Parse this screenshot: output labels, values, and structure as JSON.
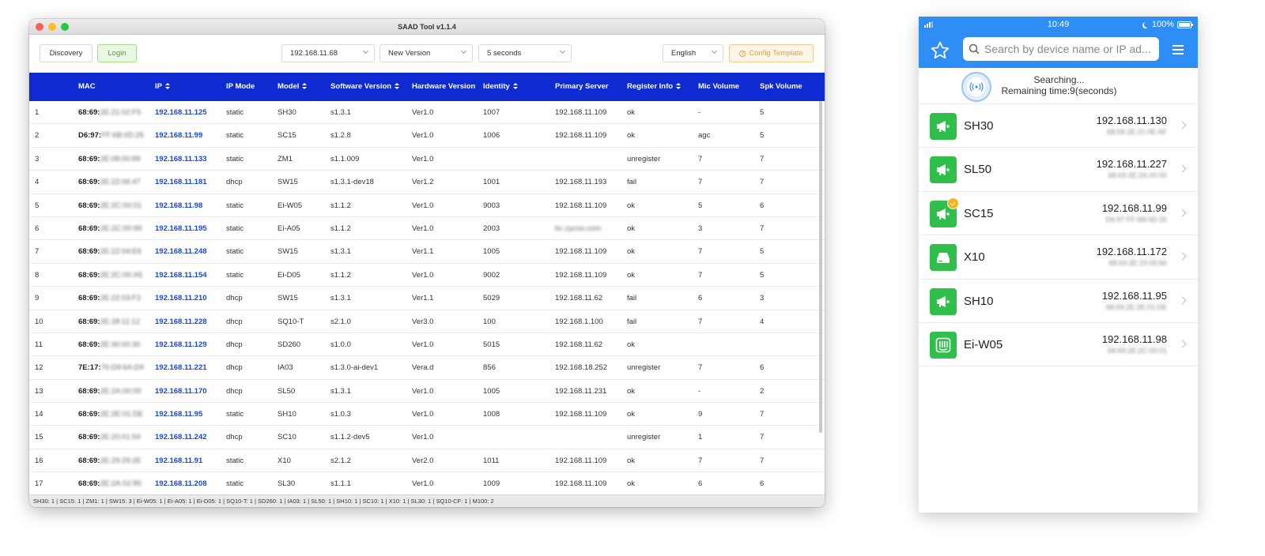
{
  "window": {
    "title": "SAAD Tool v1.1.4",
    "toolbar": {
      "discovery_label": "Discovery",
      "login_label": "Login",
      "ip_select": "192.168.11.68",
      "version_select": "New Version",
      "interval_select": "5 seconds",
      "language_select": "English",
      "config_label": "Config Template"
    },
    "columns": [
      "",
      "MAC",
      "IP",
      "IP Mode",
      "Model",
      "Software Version",
      "Hardware Version",
      "Identity",
      "Primary Server",
      "Register Info",
      "Mic Volume",
      "Spk Volume"
    ],
    "rows": [
      {
        "n": "1",
        "mac_prefix": "68:69:",
        "mac_rest": "2E:21:02:F5",
        "ip": "192.168.11.125",
        "mode": "static",
        "model": "SH30",
        "sw": "s1.3.1",
        "hw": "Ver1.0",
        "id": "1007",
        "server": "192.168.11.109",
        "server_blur": false,
        "reg": "ok",
        "mic": "-",
        "spk": "5"
      },
      {
        "n": "2",
        "mac_prefix": "D6:97:",
        "mac_rest": "FF:6B:0D:25",
        "ip": "192.168.11.99",
        "mode": "static",
        "model": "SC15",
        "sw": "s1.2.8",
        "hw": "Ver1.0",
        "id": "1006",
        "server": "192.168.11.109",
        "server_blur": false,
        "reg": "ok",
        "mic": "agc",
        "spk": "5"
      },
      {
        "n": "3",
        "mac_prefix": "68:69:",
        "mac_rest": "2E:08:00:89",
        "ip": "192.168.11.133",
        "mode": "static",
        "model": "ZM1",
        "sw": "s1.1.009",
        "hw": "Ver1.0",
        "id": "",
        "server": "",
        "server_blur": false,
        "reg": "unregister",
        "mic": "7",
        "spk": "7"
      },
      {
        "n": "4",
        "mac_prefix": "68:69:",
        "mac_rest": "2E:22:06:47",
        "ip": "192.168.11.181",
        "mode": "dhcp",
        "model": "SW15",
        "sw": "s1.3.1-dev18",
        "hw": "Ver1.2",
        "id": "1001",
        "server": "192.168.11.193",
        "server_blur": false,
        "reg": "fail",
        "mic": "7",
        "spk": "7"
      },
      {
        "n": "5",
        "mac_prefix": "68:69:",
        "mac_rest": "2E:2C:00:01",
        "ip": "192.168.11.98",
        "mode": "static",
        "model": "Ei-W05",
        "sw": "s1.1.2",
        "hw": "Ver1.0",
        "id": "9003",
        "server": "192.168.11.109",
        "server_blur": false,
        "reg": "ok",
        "mic": "5",
        "spk": "6"
      },
      {
        "n": "6",
        "mac_prefix": "68:69:",
        "mac_rest": "2E:2C:00:99",
        "ip": "192.168.11.195",
        "mode": "static",
        "model": "Ei-A05",
        "sw": "s1.1.2",
        "hw": "Ver1.0",
        "id": "2003",
        "server": "bc.zycoo.com",
        "server_blur": true,
        "reg": "ok",
        "mic": "3",
        "spk": "7"
      },
      {
        "n": "7",
        "mac_prefix": "68:69:",
        "mac_rest": "2E:22:04:E6",
        "ip": "192.168.11.248",
        "mode": "static",
        "model": "SW15",
        "sw": "s1.3.1",
        "hw": "Ver1.1",
        "id": "1005",
        "server": "192.168.11.109",
        "server_blur": false,
        "reg": "ok",
        "mic": "7",
        "spk": "5"
      },
      {
        "n": "8",
        "mac_prefix": "68:69:",
        "mac_rest": "2E:2C:00:A5",
        "ip": "192.168.11.154",
        "mode": "static",
        "model": "Ei-D05",
        "sw": "s1.1.2",
        "hw": "Ver1.0",
        "id": "9002",
        "server": "192.168.11.109",
        "server_blur": false,
        "reg": "ok",
        "mic": "7",
        "spk": "5"
      },
      {
        "n": "9",
        "mac_prefix": "68:69:",
        "mac_rest": "2E:22:03:F2",
        "ip": "192.168.11.210",
        "mode": "dhcp",
        "model": "SW15",
        "sw": "s1.3.1",
        "hw": "Ver1.1",
        "id": "5029",
        "server": "192.168.11.62",
        "server_blur": false,
        "reg": "fail",
        "mic": "6",
        "spk": "3"
      },
      {
        "n": "10",
        "mac_prefix": "68:69:",
        "mac_rest": "2E:28:11:12",
        "ip": "192.168.11.228",
        "mode": "dhcp",
        "model": "SQ10-T",
        "sw": "s2.1.0",
        "hw": "Ver3.0",
        "id": "100",
        "server": "192.168.1.100",
        "server_blur": false,
        "reg": "fail",
        "mic": "7",
        "spk": "4"
      },
      {
        "n": "11",
        "mac_prefix": "68:69:",
        "mac_rest": "2E:30:00:30",
        "ip": "192.168.11.129",
        "mode": "dhcp",
        "model": "SD260",
        "sw": "s1.0.0",
        "hw": "Ver1.0",
        "id": "5015",
        "server": "192.168.11.62",
        "server_blur": false,
        "reg": "ok",
        "mic": "",
        "spk": ""
      },
      {
        "n": "12",
        "mac_prefix": "7E:17:",
        "mac_rest": "70:D9:6A:D9",
        "ip": "192.168.11.221",
        "mode": "dhcp",
        "model": "IA03",
        "sw": "s1.3.0-ai-dev1",
        "hw": "Vera.d",
        "id": "856",
        "server": "192.168.18.252",
        "server_blur": false,
        "reg": "unregister",
        "mic": "7",
        "spk": "6"
      },
      {
        "n": "13",
        "mac_prefix": "68:69:",
        "mac_rest": "2E:2A:00:00",
        "ip": "192.168.11.170",
        "mode": "dhcp",
        "model": "SL50",
        "sw": "s1.3.1",
        "hw": "Ver1.0",
        "id": "1005",
        "server": "192.168.11.231",
        "server_blur": false,
        "reg": "ok",
        "mic": "-",
        "spk": "2"
      },
      {
        "n": "14",
        "mac_prefix": "68:69:",
        "mac_rest": "2E:2E:01:DE",
        "ip": "192.168.11.95",
        "mode": "static",
        "model": "SH10",
        "sw": "s1.0.3",
        "hw": "Ver1.0",
        "id": "1008",
        "server": "192.168.11.109",
        "server_blur": false,
        "reg": "ok",
        "mic": "9",
        "spk": "7"
      },
      {
        "n": "15",
        "mac_prefix": "68:69:",
        "mac_rest": "2E:20:01:54",
        "ip": "192.168.11.242",
        "mode": "dhcp",
        "model": "SC10",
        "sw": "s1.1.2-dev5",
        "hw": "Ver1.0",
        "id": "",
        "server": "",
        "server_blur": false,
        "reg": "unregister",
        "mic": "1",
        "spk": "7"
      },
      {
        "n": "16",
        "mac_prefix": "68:69:",
        "mac_rest": "2E:29:29:2E",
        "ip": "192.168.11.91",
        "mode": "static",
        "model": "X10",
        "sw": "s2.1.2",
        "hw": "Ver2.0",
        "id": "1011",
        "server": "192.168.11.109",
        "server_blur": false,
        "reg": "ok",
        "mic": "7",
        "spk": "7"
      },
      {
        "n": "17",
        "mac_prefix": "68:69:",
        "mac_rest": "2E:2A:02:85",
        "ip": "192.168.11.208",
        "mode": "static",
        "model": "SL30",
        "sw": "s1.1.1",
        "hw": "Ver1.0",
        "id": "1009",
        "server": "192.168.11.109",
        "server_blur": false,
        "reg": "ok",
        "mic": "6",
        "spk": "6"
      }
    ],
    "status_bar": "SH30: 1 | SC15: 1 | ZM1: 1 | SW15: 3 | Ei-W05: 1 | Ei-A05: 1 | Ei-D05: 1 | SQ10-T: 1 | SD260: 1 | IA03: 1 | SL50: 1 | SH10: 1 | SC10: 1 | X10: 1 | SL30: 1 | SQ10-CF: 1 | M100: 2",
    "accent_color": "#0e2ad0"
  },
  "mobile": {
    "time": "10:49",
    "battery": "100%",
    "search_placeholder": "Search by device name or IP ad...",
    "searching_title": "Searching...",
    "searching_time": "Remaining time:9(seconds)",
    "devices": [
      {
        "name": "SH30",
        "ip": "192.168.11.130",
        "mac": "68:69:2E:21:0E:AF",
        "icon": "speaker-icon",
        "badge": false
      },
      {
        "name": "SL50",
        "ip": "192.168.11.227",
        "mac": "68:69:2E:2A:00:00",
        "icon": "speaker-icon",
        "badge": false
      },
      {
        "name": "SC15",
        "ip": "192.168.11.99",
        "mac": "D6:97:FF:6B:0D:25",
        "icon": "speaker-icon",
        "badge": true
      },
      {
        "name": "X10",
        "ip": "192.168.11.172",
        "mac": "68:69:2E:29:00:66",
        "icon": "gateway-icon",
        "badge": false
      },
      {
        "name": "SH10",
        "ip": "192.168.11.95",
        "mac": "68:69:2E:2E:01:DE",
        "icon": "speaker-icon",
        "badge": false
      },
      {
        "name": "Ei-W05",
        "ip": "192.168.11.98",
        "mac": "68:69:2E:2C:00:01",
        "icon": "wall-panel-icon",
        "badge": false
      }
    ],
    "accent_color": "#2f8ef5",
    "device_color": "#2fbf4a"
  }
}
